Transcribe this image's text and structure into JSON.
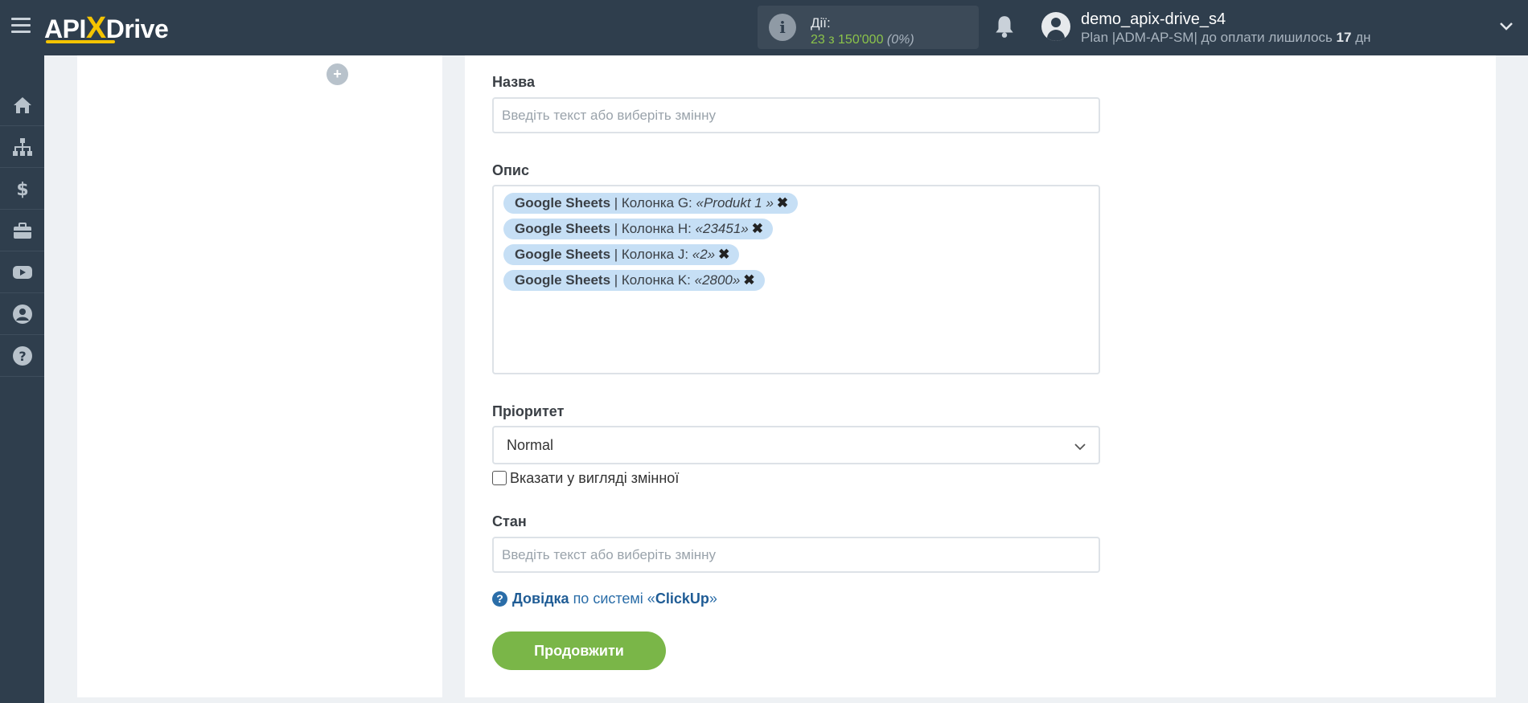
{
  "header": {
    "logo_left": "API",
    "logo_x": "X",
    "logo_right": "Drive",
    "actions_label": "Дії:",
    "actions_value": "23 з 150'000",
    "actions_percent": "(0%)",
    "user_name": "demo_apix-drive_s4",
    "plan_prefix": "Plan |ADM-AP-SM| до оплати лишилось ",
    "plan_days": "17",
    "plan_suffix": " дн"
  },
  "sidebar": {
    "items": [
      {
        "icon": "home-icon"
      },
      {
        "icon": "sitemap-icon"
      },
      {
        "icon": "dollar-icon"
      },
      {
        "icon": "briefcase-icon"
      },
      {
        "icon": "youtube-icon"
      },
      {
        "icon": "user-icon"
      },
      {
        "icon": "help-icon"
      }
    ]
  },
  "left_panel": {
    "add_label": "+"
  },
  "form": {
    "name": {
      "label": "Назва",
      "value": "",
      "placeholder": "Введіть текст або виберіть змінну"
    },
    "description": {
      "label": "Опис",
      "tags": [
        {
          "source": "Google Sheets",
          "column": " | Колонка G: ",
          "value": "«Produkt 1 »"
        },
        {
          "source": "Google Sheets",
          "column": " | Колонка H: ",
          "value": "«23451»"
        },
        {
          "source": "Google Sheets",
          "column": " | Колонка J: ",
          "value": "«2»"
        },
        {
          "source": "Google Sheets",
          "column": " | Колонка K: ",
          "value": "«2800»"
        }
      ],
      "remove_glyph": "✖"
    },
    "priority": {
      "label": "Пріоритет",
      "selected": "Normal",
      "checkbox_label": "Вказати у вигляді змінної",
      "checkbox_checked": false
    },
    "status": {
      "label": "Стан",
      "value": "",
      "placeholder": "Введіть текст або виберіть змінну"
    },
    "help": {
      "icon_glyph": "?",
      "link": "Довідка",
      "text_before": " по системі «",
      "system": "ClickUp",
      "text_after": "»"
    },
    "continue_label": "Продовжити"
  },
  "colors": {
    "topbar": "#2f3e4d",
    "accent_green": "#7ab648",
    "tag_bg": "#c6dff5",
    "link_blue": "#2a6da8",
    "logo_yellow": "#f5c400"
  }
}
